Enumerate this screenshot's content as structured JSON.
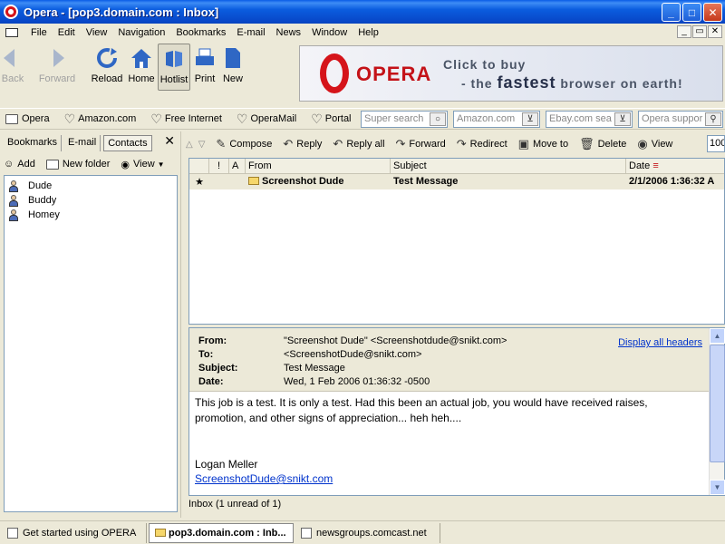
{
  "window": {
    "title": "Opera - [pop3.domain.com : Inbox]",
    "controls": {
      "minimize": "_",
      "maximize": "□",
      "close": "✕"
    }
  },
  "menu": {
    "items": [
      "File",
      "Edit",
      "View",
      "Navigation",
      "Bookmarks",
      "E-mail",
      "News",
      "Window",
      "Help"
    ],
    "mdi": {
      "minimize": "_",
      "restore": "▭",
      "close": "✕"
    }
  },
  "toolbar": {
    "back": "Back",
    "forward": "Forward",
    "reload": "Reload",
    "home": "Home",
    "hotlist": "Hotlist",
    "print": "Print",
    "new": "New"
  },
  "ad": {
    "brand": "OPERA",
    "line1": "Click to buy",
    "line2_prefix": "- the ",
    "line2_bold": "fastest",
    "line2_suffix": " browser on earth!"
  },
  "personal_bar": {
    "items": [
      "Opera",
      "Amazon.com",
      "Free Internet",
      "OperaMail",
      "Portal"
    ],
    "search_super": "Super search",
    "search_amazon": "Amazon.com",
    "search_ebay": "Ebay.com sea",
    "search_opera": "Opera suppor"
  },
  "panel": {
    "tabs": [
      "Bookmarks",
      "E-mail",
      "Contacts"
    ],
    "close": "✕",
    "add": "Add",
    "new_folder": "New folder",
    "view": "View",
    "contacts": [
      "Dude",
      "Buddy",
      "Homey"
    ]
  },
  "mail_toolbar": {
    "compose": "Compose",
    "reply": "Reply",
    "reply_all": "Reply all",
    "forward": "Forward",
    "redirect": "Redirect",
    "move_to": "Move to",
    "delete": "Delete",
    "view": "View",
    "zoom": "100"
  },
  "message_list": {
    "columns": {
      "flag": "!",
      "attach": "A",
      "from": "From",
      "subject": "Subject",
      "date": "Date"
    },
    "rows": [
      {
        "star": "★",
        "from": "Screenshot Dude",
        "subject": "Test Message",
        "date": "2/1/2006 1:36:32 A"
      }
    ]
  },
  "preview": {
    "from_label": "From:",
    "from": "\"Screenshot Dude\" <Screenshotdude@snikt.com>",
    "to_label": "To:",
    "to": "<ScreenshotDude@snikt.com>",
    "subject_label": "Subject:",
    "subject": "Test Message",
    "date_label": "Date:",
    "date": "Wed, 1 Feb 2006 01:36:32 -0500",
    "display_all": "Display all headers",
    "body_line1": "This job is a test.  It is only a test.  Had this been an actual job, you would have received raises,",
    "body_line2": "promotion, and other signs of appreciation... heh heh....",
    "sig_name": "Logan Meller",
    "sig_email": "ScreenshotDude@snikt.com"
  },
  "status": "Inbox (1 unread of 1)",
  "page_tabs": [
    "Get started using OPERA",
    "pop3.domain.com : Inb...",
    "newsgroups.comcast.net"
  ]
}
